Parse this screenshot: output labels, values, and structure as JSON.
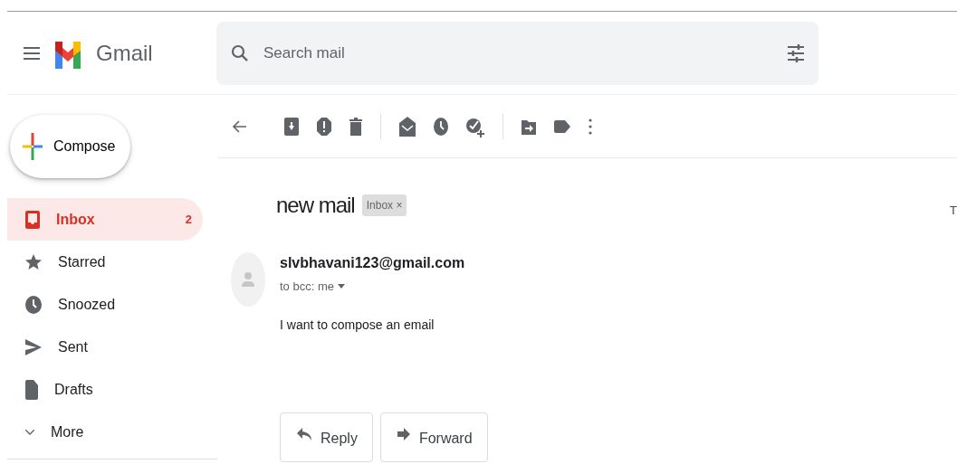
{
  "app": {
    "name": "Gmail"
  },
  "search": {
    "placeholder": "Search mail"
  },
  "compose": {
    "label": "Compose"
  },
  "sidebar": {
    "items": [
      {
        "label": "Inbox",
        "kind": "inbox",
        "count": "2",
        "selected": true
      },
      {
        "label": "Starred",
        "kind": "star",
        "selected": false
      },
      {
        "label": "Snoozed",
        "kind": "clock",
        "selected": false
      },
      {
        "label": "Sent",
        "kind": "send",
        "selected": false
      },
      {
        "label": "Drafts",
        "kind": "draft",
        "selected": false
      },
      {
        "label": "More",
        "kind": "more",
        "selected": false
      }
    ]
  },
  "message": {
    "subject": "new mail",
    "label_chip": "Inbox",
    "chip_close": "×",
    "sender": "slvbhavani123@gmail.com",
    "recipients": "to bcc: me",
    "body": "I want to compose an email",
    "cut_text": "T"
  },
  "actions": [
    {
      "label": "Reply",
      "kind": "reply"
    },
    {
      "label": "Forward",
      "kind": "forward"
    }
  ]
}
